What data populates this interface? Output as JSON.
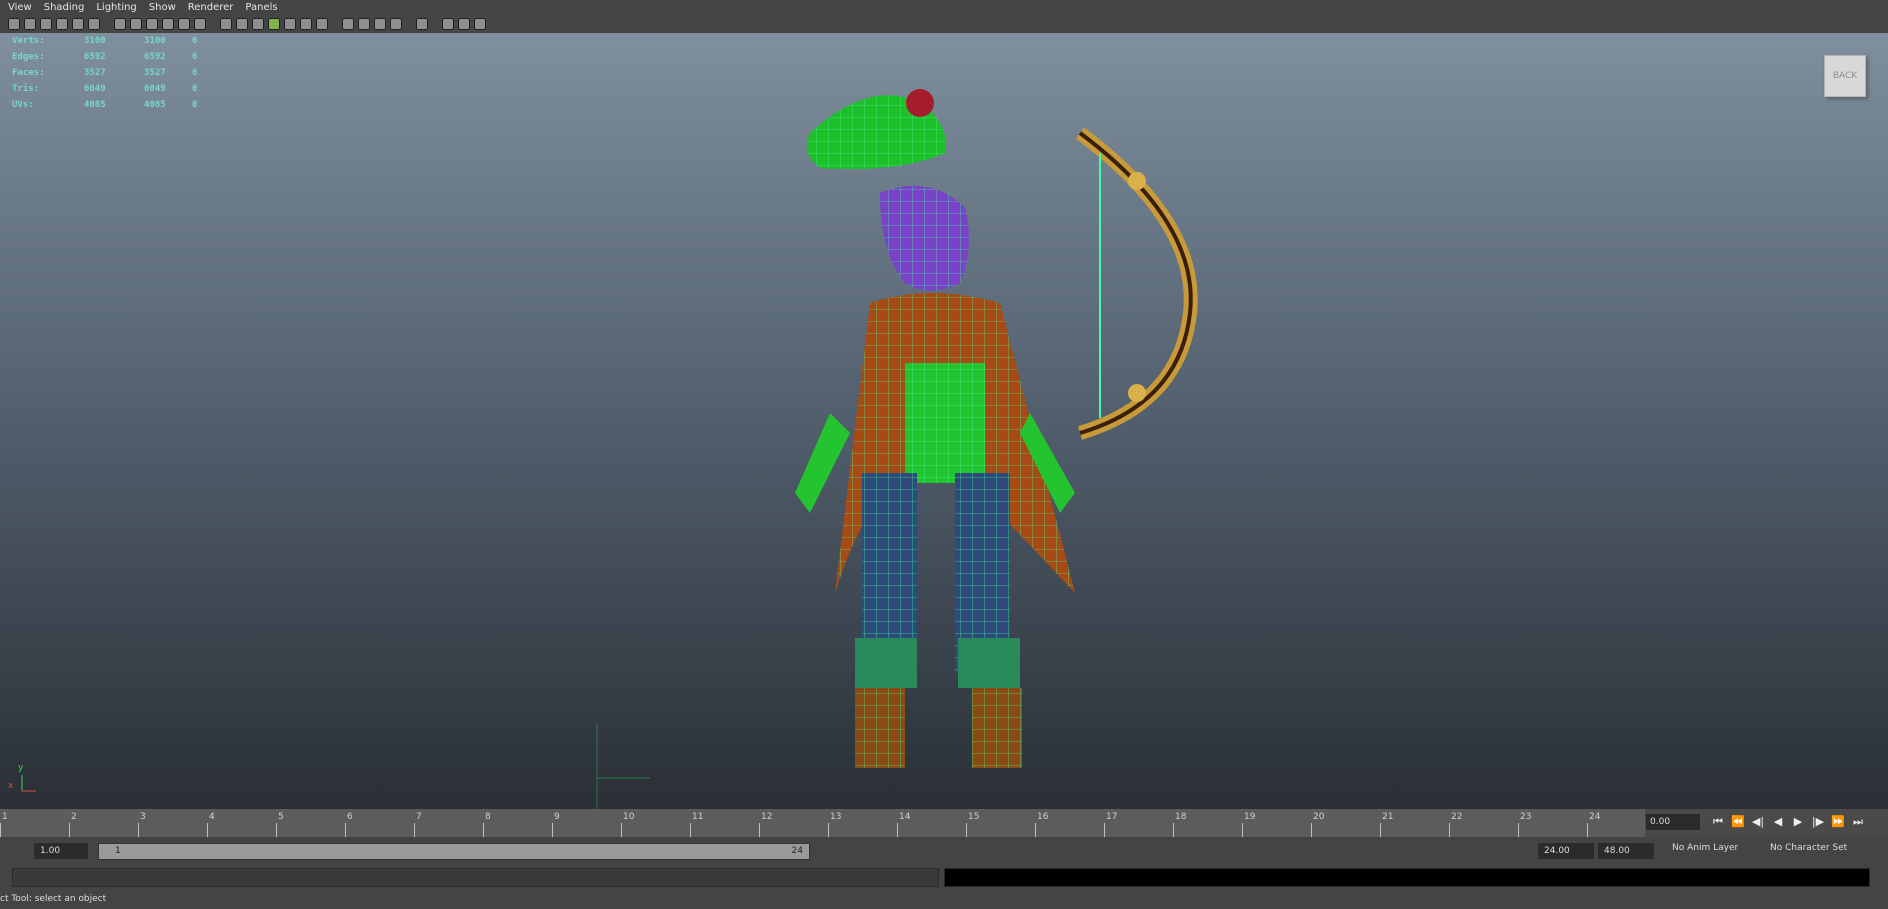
{
  "menu": {
    "items": [
      "View",
      "Shading",
      "Lighting",
      "Show",
      "Renderer",
      "Panels"
    ]
  },
  "toolbar": {
    "icons": [
      "camera-icon",
      "bookmark-icon",
      "image-plane-icon",
      "grid-icon",
      "select-camera-icon",
      "film-gate-icon",
      "resolution-gate-icon",
      "gate-mask-icon",
      "field-chart-icon",
      "safe-action-icon",
      "safe-title-icon",
      "wireframe-icon",
      "smooth-shade-icon",
      "wireframe-on-shaded-icon",
      "default-material-icon",
      "textured-icon",
      "use-all-lights-icon",
      "shadows-icon",
      "ambient-occlusion-icon",
      "anti-aliasing-icon",
      "motion-blur-icon",
      "screen-space-icon",
      "isolate-select-icon",
      "xray-icon",
      "xray-joints-icon",
      "backface-icon"
    ]
  },
  "hud": {
    "rows": [
      {
        "label": "Verts:",
        "v1": "3100",
        "v2": "3100",
        "v3": "0"
      },
      {
        "label": "Edges:",
        "v1": "6592",
        "v2": "6592",
        "v3": "0"
      },
      {
        "label": "Faces:",
        "v1": "3527",
        "v2": "3527",
        "v3": "0"
      },
      {
        "label": "Tris:",
        "v1": "6049",
        "v2": "6049",
        "v3": "0"
      },
      {
        "label": "UVs:",
        "v1": "4085",
        "v2": "4085",
        "v3": "0"
      }
    ]
  },
  "viewcube": {
    "label": "BACK"
  },
  "axis": {
    "y": "y",
    "x": "x"
  },
  "timeline": {
    "ticks": [
      "1",
      "2",
      "3",
      "4",
      "5",
      "6",
      "7",
      "8",
      "9",
      "10",
      "11",
      "12",
      "13",
      "14",
      "15",
      "16",
      "17",
      "18",
      "19",
      "20",
      "21",
      "22",
      "23",
      "24"
    ],
    "current_frame": "0.00",
    "playback": [
      "⏮",
      "⏪",
      "◀|",
      "◀",
      "▶",
      "|▶",
      "⏩",
      "⏭"
    ]
  },
  "range": {
    "start_field": "1.00",
    "slider_start": "1",
    "slider_end": "24",
    "end_field": "24.00",
    "max_field": "48.00",
    "anim_layer": "No Anim Layer",
    "character_set": "No Character Set"
  },
  "help": {
    "text": "ct Tool: select an object"
  },
  "colors": {
    "accent": "#7fb24a",
    "hud_text": "#79d6c8",
    "wire": "#39ff6a"
  }
}
